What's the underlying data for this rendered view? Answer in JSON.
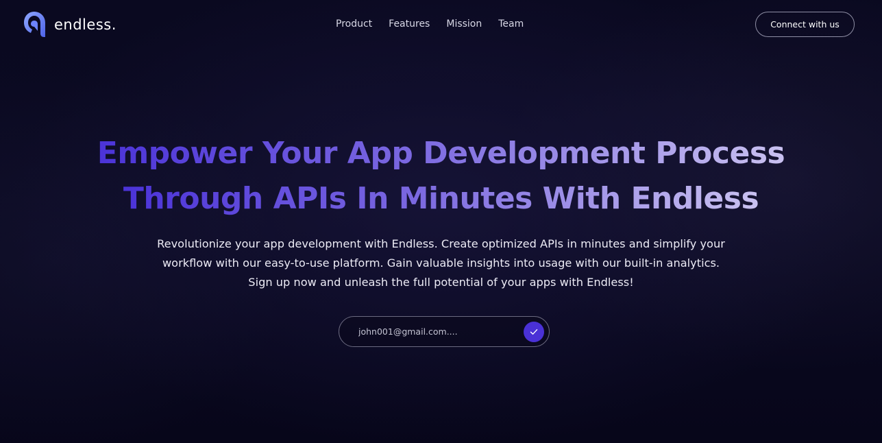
{
  "brand": {
    "name": "endless.",
    "logo_icon": "endless-logo-icon"
  },
  "nav": {
    "items": [
      {
        "label": "Product"
      },
      {
        "label": "Features"
      },
      {
        "label": "Mission"
      },
      {
        "label": "Team"
      }
    ]
  },
  "header": {
    "cta_label": "Connect with us"
  },
  "hero": {
    "title_line_1": "Empower Your App Development Process",
    "title_line_2": "Through APIs In Minutes With Endless",
    "description": "Revolutionize your app development with Endless. Create optimized APIs in minutes and simplify your workflow with our easy-to-use platform. Gain valuable insights into usage with our built-in analytics. Sign up now and unleash the full potential of your apps with Endless!"
  },
  "signup": {
    "email_placeholder": "john001@gmail.com....",
    "email_value": "",
    "submit_icon": "check-icon"
  },
  "colors": {
    "background": "#07061a",
    "accent": "#4a31d6",
    "title_gradient_start": "#4b33d8",
    "title_gradient_end": "#c9c1f0"
  }
}
